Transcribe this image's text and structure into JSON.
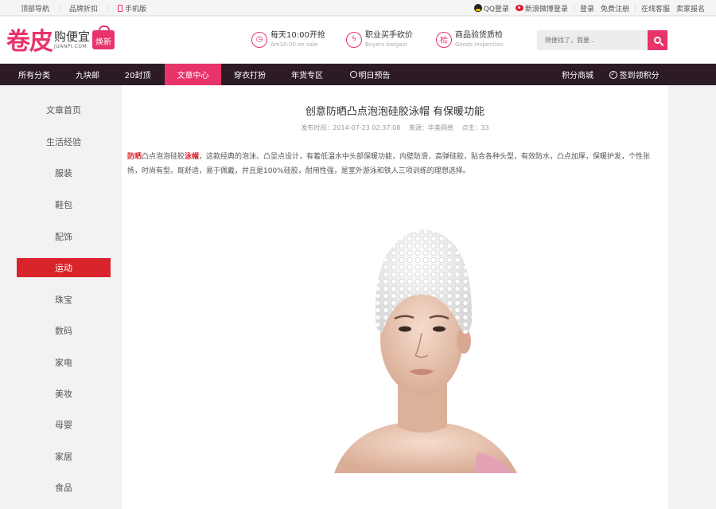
{
  "topbar": {
    "left": [
      "顶部导航",
      "品牌折扣",
      "手机版"
    ],
    "qq_login": "QQ登录",
    "weibo_login": "新浪微博登录",
    "login": "登录",
    "register": "免费注册",
    "support": "在线客服",
    "seller": "卖家报名"
  },
  "logo": {
    "main": "卷皮",
    "sub_cn": "购便宜",
    "sub_en": "JUANPI.COM",
    "badge": "焕新"
  },
  "promos": [
    {
      "icon": "clock-icon",
      "glyph": "◷",
      "title": "每天10:00开抢",
      "sub": "Am10:00 on sale"
    },
    {
      "icon": "lightning-icon",
      "glyph": "ϟ",
      "title": "职业买手砍价",
      "sub": "Buyers bargain"
    },
    {
      "icon": "inspect-icon",
      "glyph": "检",
      "title": "商品验货质检",
      "sub": "Goods inspection"
    }
  ],
  "search": {
    "placeholder": "随便找了，我要..."
  },
  "nav": {
    "items": [
      "所有分类",
      "九块邮",
      "20封顶",
      "文章中心",
      "穿衣打扮",
      "年货专区",
      "明日预告"
    ],
    "active": "文章中心",
    "points_mall": "积分商城",
    "sign_in": "签到领积分"
  },
  "sidebar": {
    "items": [
      "文章首页",
      "生活经验",
      "服装",
      "鞋包",
      "配饰",
      "运动",
      "珠宝",
      "数码",
      "家电",
      "美妆",
      "母婴",
      "家居",
      "食品"
    ],
    "active": "运动"
  },
  "article": {
    "title": "创意防晒凸点泡泡硅胶泳帽 有保暖功能",
    "publish_time": "发布时间：2014-07-23 02:37:08",
    "source": "来源：华美网络",
    "clicks": "点击：33",
    "kw1": "防晒",
    "text1": "凸点泡泡硅胶",
    "kw2": "泳帽",
    "text2": "，这款经典的泡沫、凸显点设计，有着低温水中头部保暖功能，内壁防滑，高弹硅胶，贴合各种头型，有效防水，凸点加厚，保暖护发，个性张扬，时尚有型。既舒适，易于佩戴，并且是100%硅胶，耐用性强，是室外游泳和铁人三项训练的理想选择。"
  },
  "colors": {
    "brand": "#e8336b",
    "nav_bg": "#2c1b25",
    "sidebar_active": "#d8232a"
  }
}
